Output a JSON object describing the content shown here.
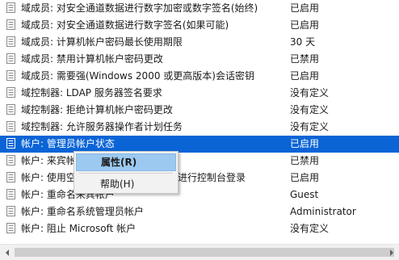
{
  "policies": [
    {
      "name": "域成员: 对安全通道数据进行数字加密或数字签名(始终)",
      "setting": "已启用",
      "selected": false
    },
    {
      "name": "域成员: 对安全通道数据进行数字签名(如果可能)",
      "setting": "已启用",
      "selected": false
    },
    {
      "name": "域成员: 计算机帐户密码最长使用期限",
      "setting": "30 天",
      "selected": false
    },
    {
      "name": "域成员: 禁用计算机帐户密码更改",
      "setting": "已禁用",
      "selected": false
    },
    {
      "name": "域成员: 需要强(Windows 2000 或更高版本)会话密钥",
      "setting": "已启用",
      "selected": false
    },
    {
      "name": "域控制器: LDAP 服务器签名要求",
      "setting": "没有定义",
      "selected": false
    },
    {
      "name": "域控制器: 拒绝计算机帐户密码更改",
      "setting": "没有定义",
      "selected": false
    },
    {
      "name": "域控制器: 允许服务器操作者计划任务",
      "setting": "没有定义",
      "selected": false
    },
    {
      "name": "帐户: 管理员帐户状态",
      "setting": "已启用",
      "selected": true
    },
    {
      "name": "帐户: 来宾帐",
      "setting": "已禁用",
      "selected": false
    },
    {
      "name": "帐户: 使用空",
      "name_tail": "进行控制台登录",
      "setting": "已启用",
      "selected": false
    },
    {
      "name": "帐户: 重命名来宾帐户",
      "setting": "Guest",
      "selected": false
    },
    {
      "name": "帐户: 重命名系统管理员帐户",
      "setting": "Administrator",
      "selected": false
    },
    {
      "name": "帐户: 阻止 Microsoft 帐户",
      "setting": "没有定义",
      "selected": false
    }
  ],
  "context_menu": {
    "items": [
      {
        "label": "属性(R)",
        "highlighted": true
      },
      {
        "label": "帮助(H)",
        "highlighted": false
      }
    ]
  },
  "colors": {
    "selection": "#0a64d6",
    "menu_hover": "#9cc9f0"
  },
  "icons": {
    "policy_row": "policy-document-icon",
    "scroll_left": "scroll-left-arrow-icon",
    "scroll_right": "scroll-right-arrow-icon"
  }
}
